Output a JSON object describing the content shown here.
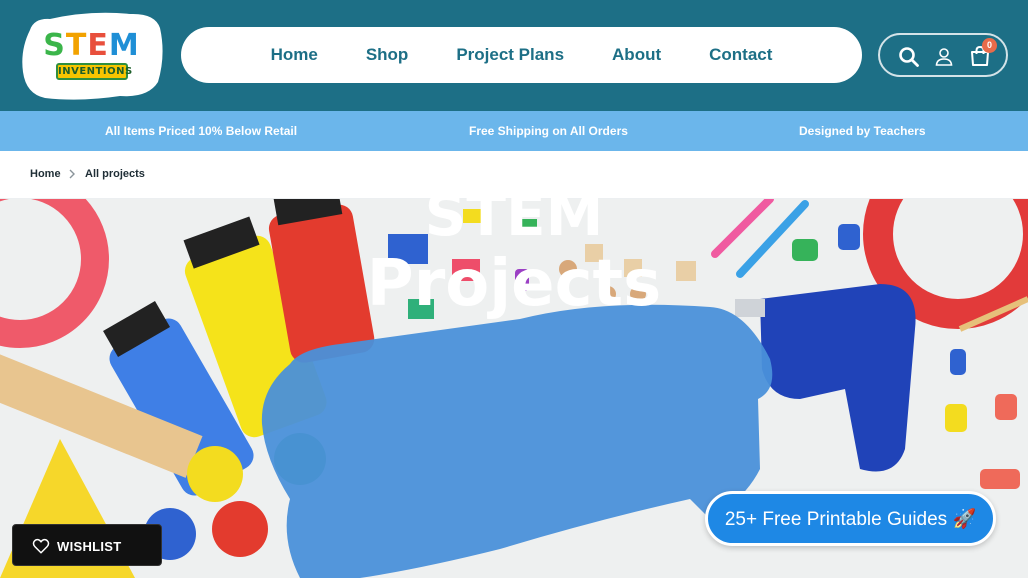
{
  "logo": {
    "main": [
      "S",
      "T",
      "E",
      "M"
    ],
    "sub": "INVENTIONS"
  },
  "nav": {
    "items": [
      "Home",
      "Shop",
      "Project Plans",
      "About",
      "Contact"
    ]
  },
  "cart": {
    "count": "0"
  },
  "icons": {
    "search": "search-icon",
    "account": "user-icon",
    "cart": "cart-icon",
    "wishlist": "heart-icon",
    "breadcrumb_separator": "chevron-right-icon"
  },
  "promo": {
    "left": "All Items Priced 10% Below Retail",
    "center": "Free Shipping on All Orders",
    "right": "Designed by Teachers"
  },
  "breadcrumb": {
    "home": "Home",
    "current": "All projects"
  },
  "hero": {
    "title_line1": "STEM",
    "title_line2": "Projects",
    "cta": "25+ Free Printable Guides 🚀"
  },
  "wishlist": {
    "label": "WISHLIST"
  },
  "colors": {
    "header": "#1d6f86",
    "promo_bar": "#6bb6eb",
    "accent_blue": "#1e88e5",
    "paint_stroke": "#4a90d9"
  }
}
